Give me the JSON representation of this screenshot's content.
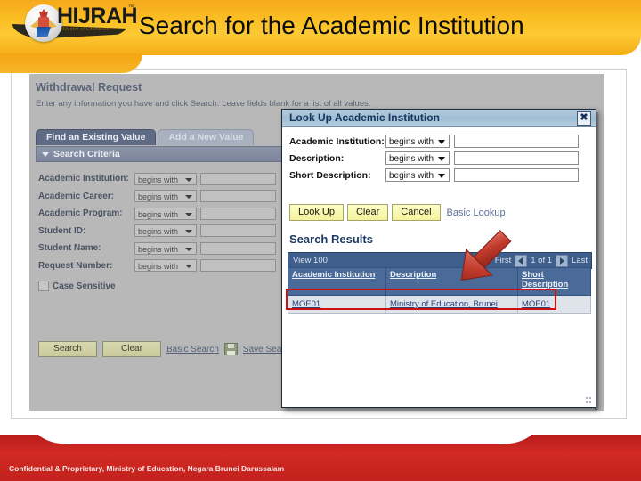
{
  "header": {
    "logo_word": "HIJRAH",
    "logo_tm": "™",
    "logo_tagline": "Ministry of Education",
    "title": "Search for the Academic Institution"
  },
  "page": {
    "title": "Withdrawal Request",
    "intro": "Enter any information you have and click Search. Leave fields blank for a list of all values.",
    "tabs": [
      {
        "label": "Find an Existing Value",
        "active": true
      },
      {
        "label": "Add a New Value",
        "active": false
      }
    ],
    "section_header": "Search Criteria",
    "fields": [
      {
        "label": "Academic Institution:",
        "operator": "begins with",
        "value": ""
      },
      {
        "label": "Academic Career:",
        "operator": "begins with",
        "value": ""
      },
      {
        "label": "Academic Program:",
        "operator": "begins with",
        "value": ""
      },
      {
        "label": "Student ID:",
        "operator": "begins with",
        "value": ""
      },
      {
        "label": "Student Name:",
        "operator": "begins with",
        "value": ""
      },
      {
        "label": "Request Number:",
        "operator": "begins with",
        "value": ""
      }
    ],
    "case_sensitive_label": "Case Sensitive",
    "actions": {
      "search": "Search",
      "clear": "Clear",
      "basic_search": "Basic Search",
      "save_search": "Save Search"
    }
  },
  "lookup": {
    "title": "Look Up Academic Institution",
    "close_label": "✖",
    "fields": [
      {
        "label": "Academic Institution:",
        "operator": "begins with",
        "value": ""
      },
      {
        "label": "Description:",
        "operator": "begins with",
        "value": ""
      },
      {
        "label": "Short Description:",
        "operator": "begins with",
        "value": ""
      }
    ],
    "buttons": {
      "look_up": "Look Up",
      "clear": "Clear",
      "cancel": "Cancel",
      "basic_lookup": "Basic Lookup"
    },
    "results": {
      "title": "Search Results",
      "view_count": "View 100",
      "pager": {
        "first": "First",
        "range": "1 of 1",
        "last": "Last"
      },
      "columns": [
        "Academic Institution",
        "Description",
        "Short Description"
      ],
      "rows": [
        [
          "MOE01",
          "Ministry of Education, Brunei",
          "MOE01"
        ]
      ]
    }
  },
  "annotation": {
    "highlight_color": "#d01010",
    "arrow_color": "#c0392b"
  },
  "footer": {
    "text": "Confidential & Proprietary, Ministry of Education, Negara Brunei Darussalam"
  }
}
